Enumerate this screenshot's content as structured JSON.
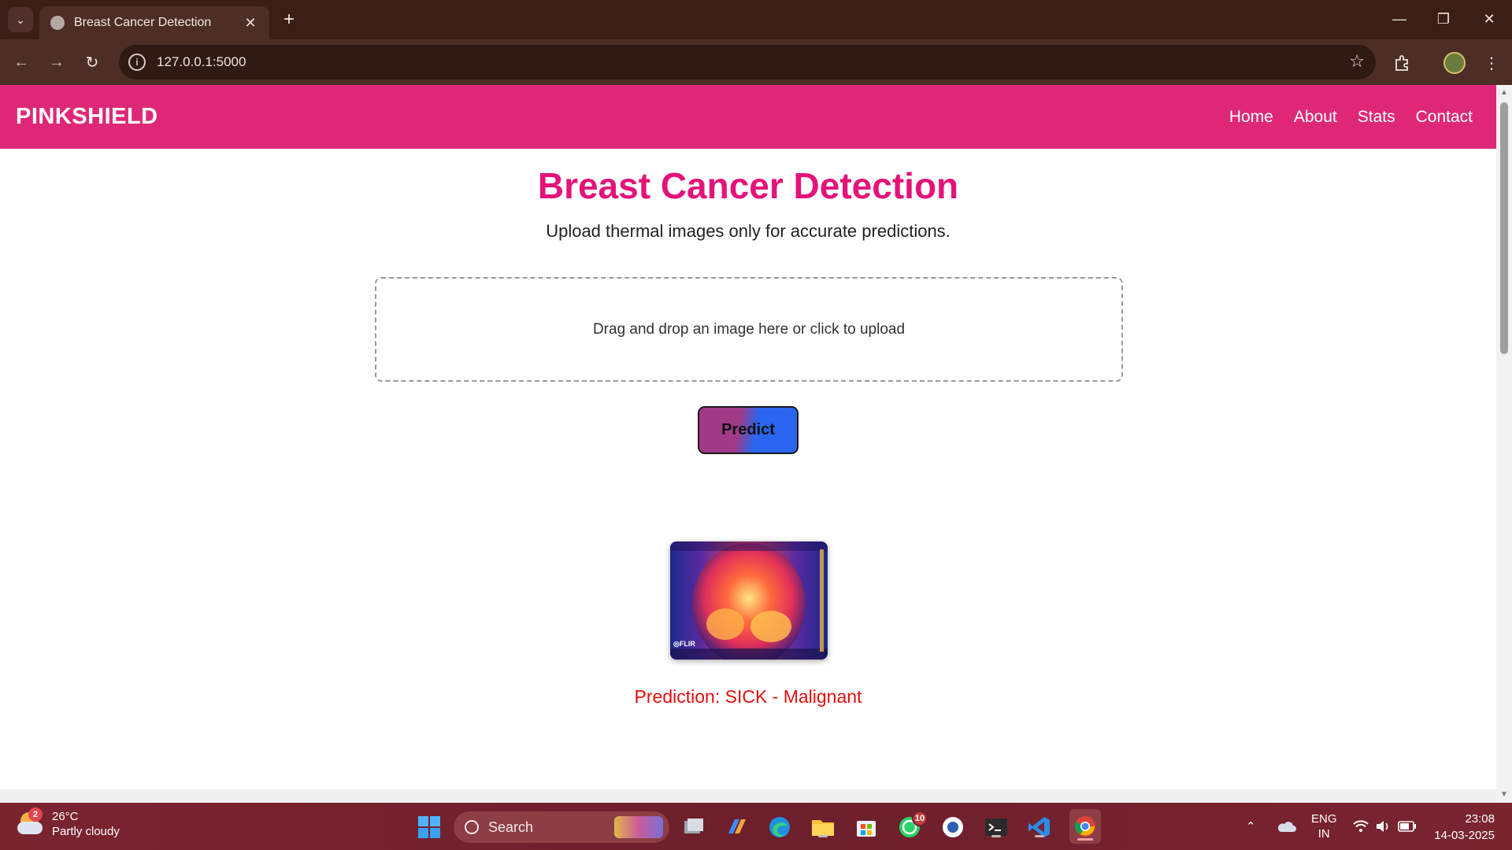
{
  "browser": {
    "tab_title": "Breast Cancer Detection",
    "url": "127.0.0.1:5000",
    "icons": [
      "tab-search-icon",
      "close-icon",
      "plus-icon",
      "back-icon",
      "forward-icon",
      "reload-icon",
      "site-info-icon",
      "star-icon",
      "extensions-icon",
      "avatar",
      "menu-icon",
      "minimize-icon",
      "restore-icon",
      "close-window-icon"
    ]
  },
  "site": {
    "brand": "PINKSHIELD",
    "nav": [
      {
        "label": "Home"
      },
      {
        "label": "About"
      },
      {
        "label": "Stats"
      },
      {
        "label": "Contact"
      }
    ],
    "colors": {
      "navbar": "#de2877",
      "title": "#e3137a",
      "prediction": "#e20e0e",
      "button_blue": "#2965ee",
      "button_pink": "#a13a86"
    }
  },
  "main": {
    "title": "Breast Cancer Detection",
    "subtitle": "Upload thermal images only for accurate predictions.",
    "dropzone_text": "Drag and drop an image here or click to upload",
    "predict_label": "Predict",
    "thermal_logo": "◎FLIR",
    "prediction": "Prediction: SICK - Malignant"
  },
  "taskbar": {
    "weather": {
      "temp": "26°C",
      "desc": "Partly cloudy",
      "badge": "2"
    },
    "search_placeholder": "Search",
    "whatsapp_badge": "10",
    "lang_top": "ENG",
    "lang_bottom": "IN",
    "time": "23:08",
    "date": "14-03-2025"
  }
}
